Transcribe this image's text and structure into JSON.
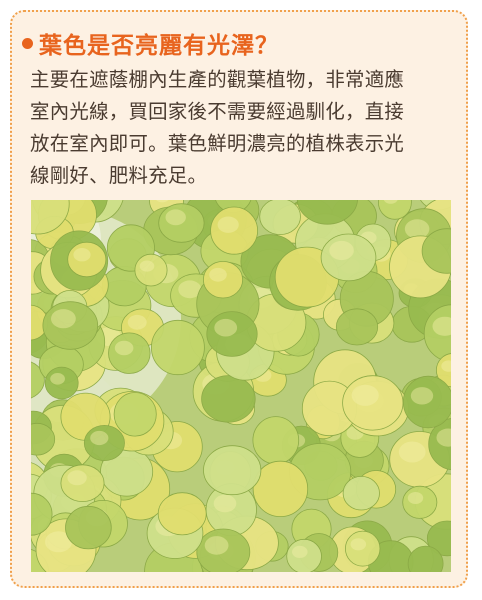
{
  "heading": "葉色是否亮麗有光澤？",
  "body_lines": [
    "主要在遮蔭棚內生產的觀葉植物，非常適應",
    "室內光線，買回家後不需要經過馴化，直接",
    "放在室內即可。葉色鮮明濃亮的植株表示光",
    "線剛好、肥料充足。"
  ],
  "photo": {
    "subject": "golden-creeping-jenny-foliage"
  },
  "colors": {
    "accent": "#e8641e",
    "frame": "#f0a04b",
    "panel": "#fdf1e3",
    "text": "#4a3b30"
  }
}
